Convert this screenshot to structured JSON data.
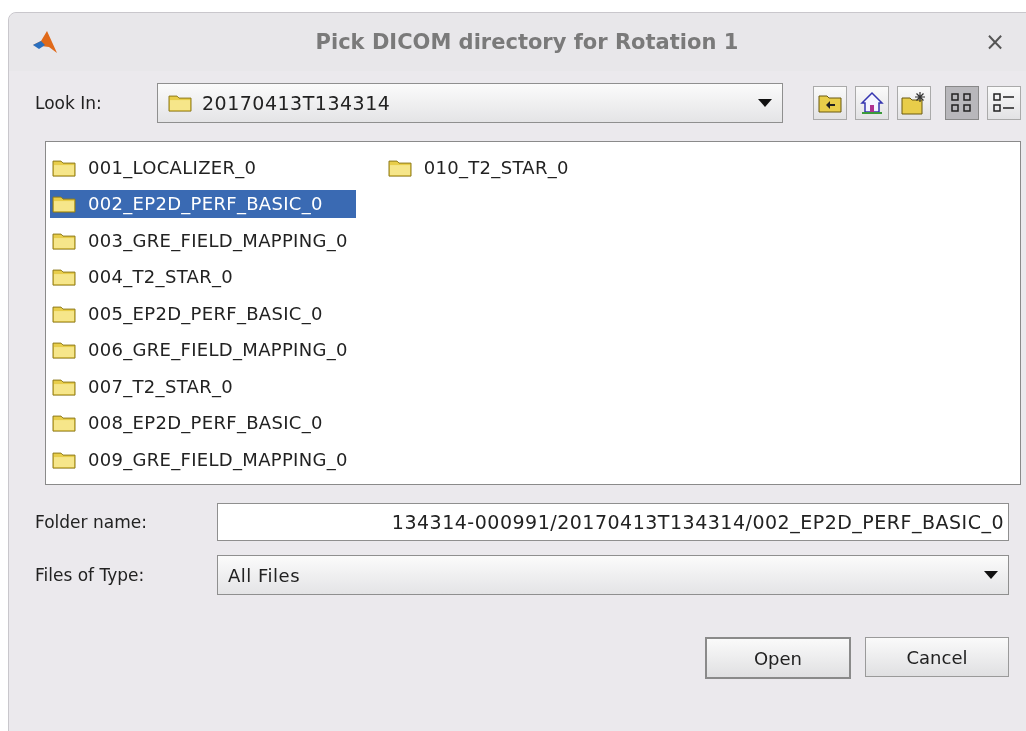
{
  "window": {
    "title": "Pick DICOM directory for Rotation 1",
    "close": "×"
  },
  "look_in": {
    "label": "Look In:",
    "value": "20170413T134314"
  },
  "toolbar": [
    {
      "kind": "up"
    },
    {
      "kind": "home"
    },
    {
      "kind": "new-folder"
    },
    {
      "kind": "list",
      "selected": true
    },
    {
      "kind": "details",
      "selected": false
    }
  ],
  "files": [
    {
      "name": "001_LOCALIZER_0",
      "selected": false
    },
    {
      "name": "002_EP2D_PERF_BASIC_0",
      "selected": true
    },
    {
      "name": "003_GRE_FIELD_MAPPING_0",
      "selected": false
    },
    {
      "name": "004_T2_STAR_0",
      "selected": false
    },
    {
      "name": "005_EP2D_PERF_BASIC_0",
      "selected": false
    },
    {
      "name": "006_GRE_FIELD_MAPPING_0",
      "selected": false
    },
    {
      "name": "007_T2_STAR_0",
      "selected": false
    },
    {
      "name": "008_EP2D_PERF_BASIC_0",
      "selected": false
    },
    {
      "name": "009_GRE_FIELD_MAPPING_0",
      "selected": false
    },
    {
      "name": "010_T2_STAR_0",
      "selected": false
    }
  ],
  "folder_name": {
    "label": "Folder name:",
    "value": "134314-000991/20170413T134314/002_EP2D_PERF_BASIC_0"
  },
  "files_of_type": {
    "label": "Files of Type:",
    "value": "All Files"
  },
  "buttons": [
    "Open",
    "Cancel"
  ]
}
